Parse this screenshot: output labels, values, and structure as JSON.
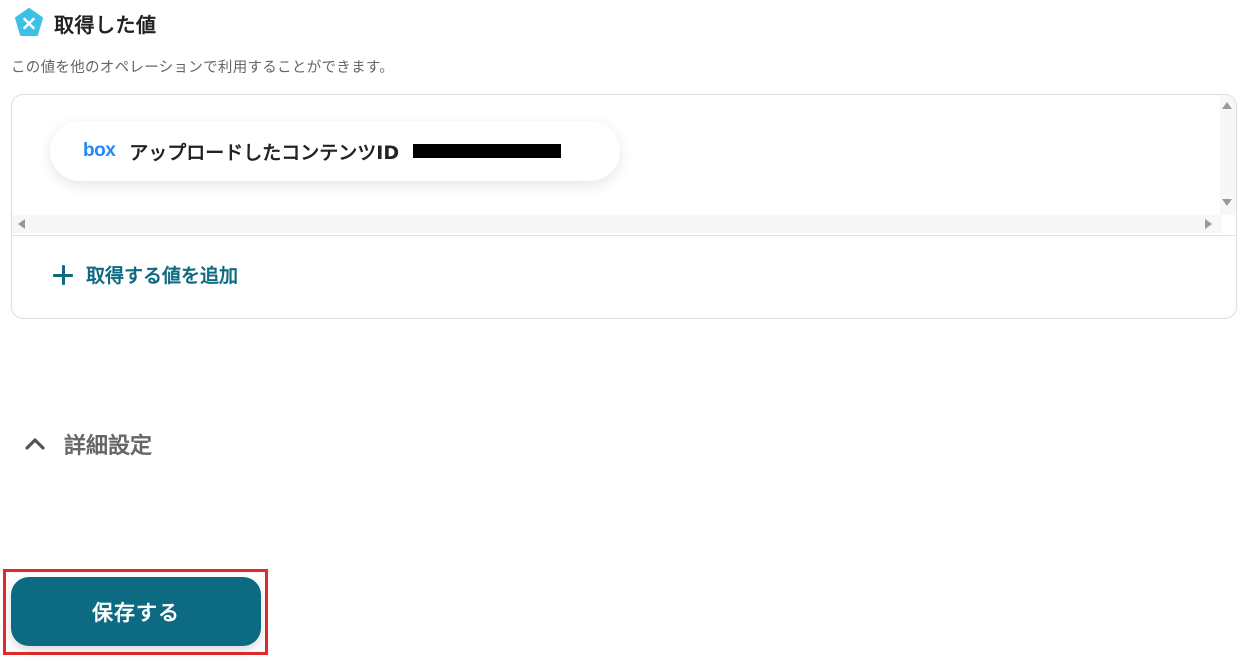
{
  "header": {
    "title": "取得した値",
    "icon": "x-variable-icon",
    "badge_color": "#3cc0e6"
  },
  "subtitle": "この値を他のオペレーションで利用することができます。",
  "values": [
    {
      "service_logo": "box",
      "label": "アップロードしたコンテンツID",
      "value_redacted": true
    }
  ],
  "add_value": {
    "label": "取得する値を追加",
    "icon": "plus-icon"
  },
  "details": {
    "label": "詳細設定",
    "icon": "chevron-up-icon",
    "expanded": true
  },
  "save": {
    "label": "保存する",
    "color": "#0c6a82",
    "highlight_color": "#e02a2a"
  }
}
